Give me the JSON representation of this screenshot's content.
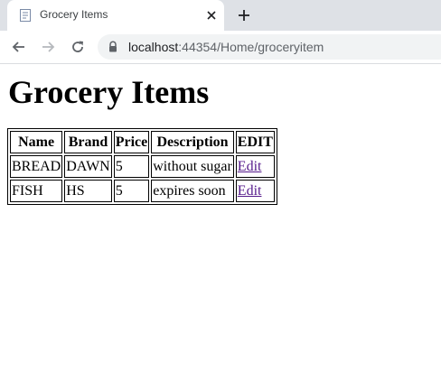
{
  "browser": {
    "tab": {
      "title": "Grocery Items",
      "favicon_icon": "document-icon",
      "close_icon": "close-icon"
    },
    "new_tab_icon": "plus-icon",
    "toolbar": {
      "back_icon": "arrow-left-icon",
      "forward_icon": "arrow-right-icon",
      "reload_icon": "reload-icon",
      "lock_icon": "lock-icon",
      "url_host": "localhost",
      "url_rest": ":44354/Home/groceryitem"
    },
    "colors": {
      "tabstrip_bg": "#dee1e6",
      "omnibox_bg": "#f1f3f4",
      "visited_link": "#551a8b"
    }
  },
  "page": {
    "heading": "Grocery Items",
    "table": {
      "headers": [
        "Name",
        "Brand",
        "Price",
        "Description",
        "EDIT"
      ],
      "rows": [
        {
          "name": "BREAD",
          "brand": "DAWN",
          "price": "5",
          "description": "without sugar",
          "edit": "Edit"
        },
        {
          "name": "FISH",
          "brand": "HS",
          "price": "5",
          "description": "expires soon",
          "edit": "Edit"
        }
      ]
    }
  }
}
